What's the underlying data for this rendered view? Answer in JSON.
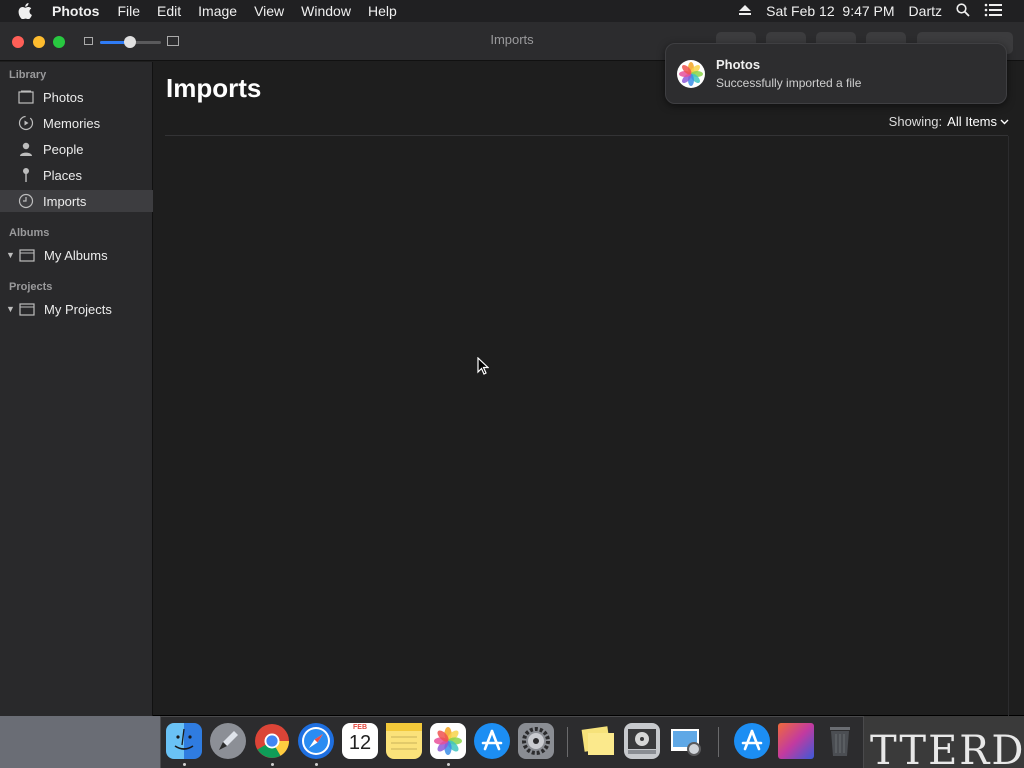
{
  "menubar": {
    "app_name": "Photos",
    "items": [
      "File",
      "Edit",
      "Image",
      "View",
      "Window",
      "Help"
    ],
    "datetime": "Sat Feb 12  9:47 PM",
    "user": "Dartz"
  },
  "window": {
    "title": "Imports"
  },
  "sidebar": {
    "library_header": "Library",
    "items": [
      {
        "label": "Photos",
        "icon": "photos-icon"
      },
      {
        "label": "Memories",
        "icon": "memories-icon"
      },
      {
        "label": "People",
        "icon": "people-icon"
      },
      {
        "label": "Places",
        "icon": "pin-icon"
      },
      {
        "label": "Imports",
        "icon": "clock-icon",
        "selected": true
      }
    ],
    "albums_header": "Albums",
    "albums_item": "My Albums",
    "projects_header": "Projects",
    "projects_item": "My Projects"
  },
  "main": {
    "title": "Imports",
    "showing_label": "Showing:",
    "showing_value": "All Items"
  },
  "notification": {
    "title": "Photos",
    "message": "Successfully imported a file"
  },
  "dock": {
    "apps": [
      "finder-icon",
      "launchpad-icon",
      "chrome-icon",
      "safari-icon",
      "calendar-icon",
      "notes-icon",
      "photos-icon",
      "app-store-icon",
      "system-preferences-icon",
      "stickies-icon",
      "dvd-player-icon",
      "preview-icon",
      "app-store-folder-icon",
      "downloads-icon",
      "trash-icon"
    ],
    "calendar_month": "FEB",
    "calendar_day": "12"
  },
  "colors": {
    "accent": "#2f7cf6",
    "selected_row": "#3d3d40",
    "window_bg": "#1e1e1e",
    "sidebar_bg": "#29292b"
  }
}
